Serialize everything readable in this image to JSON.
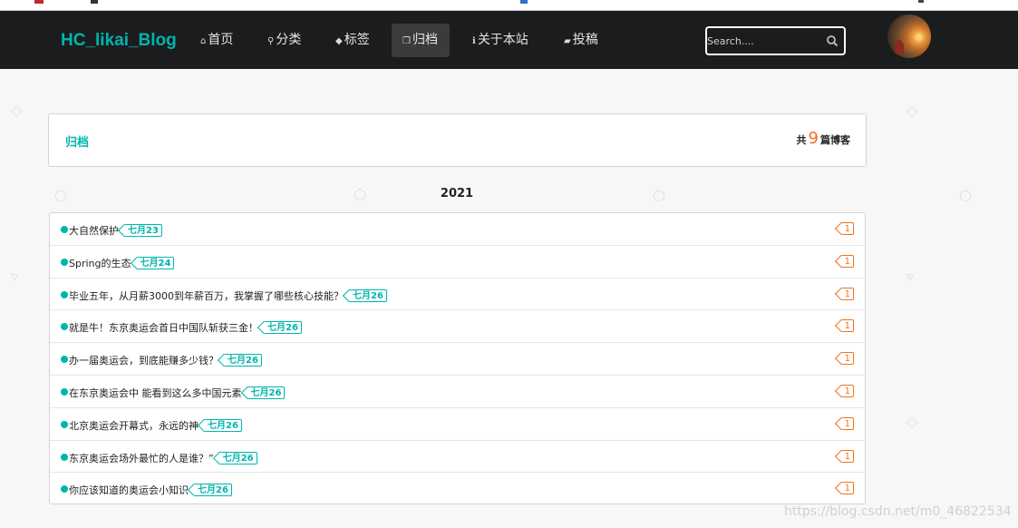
{
  "navbar": {
    "brand": "HC_likai_Blog",
    "items": [
      {
        "label": "首页",
        "icon": "home-icon"
      },
      {
        "label": "分类",
        "icon": "map-pin-icon"
      },
      {
        "label": "标签",
        "icon": "tags-icon"
      },
      {
        "label": "归档",
        "icon": "clone-icon",
        "active": true
      },
      {
        "label": "关于本站",
        "icon": "info-icon"
      },
      {
        "label": "投稿",
        "icon": "book-icon"
      }
    ],
    "search": {
      "placeholder": "Search...."
    }
  },
  "header": {
    "title": "归档",
    "count_prefix": "共",
    "count": "9",
    "count_suffix": "篇博客"
  },
  "archive": {
    "year": "2021",
    "posts": [
      {
        "title": "大自然保护",
        "date": "七月23",
        "comments": "1"
      },
      {
        "title": "Spring的生态",
        "date": "七月24",
        "comments": "1"
      },
      {
        "title": "毕业五年，从月薪3000到年薪百万，我掌握了哪些核心技能？",
        "date": "七月26",
        "comments": "1"
      },
      {
        "title": "就是牛！东京奥运会首日中国队斩获三金！",
        "date": "七月26",
        "comments": "1"
      },
      {
        "title": "办一届奥运会，到底能赚多少钱？",
        "date": "七月26",
        "comments": "1"
      },
      {
        "title": "在东京奥运会中 能看到这么多中国元素",
        "date": "七月26",
        "comments": "1"
      },
      {
        "title": "北京奥运会开幕式，永远的神",
        "date": "七月26",
        "comments": "1"
      },
      {
        "title": "东京奥运会场外最忙的人是谁？”",
        "date": "七月26",
        "comments": "1"
      },
      {
        "title": "你应该知道的奥运会小知识",
        "date": "七月26",
        "comments": "1"
      }
    ]
  },
  "watermark": "https://blog.csdn.net/m0_46822534",
  "colors": {
    "accent": "#00b5ad",
    "comment": "#f2711c",
    "navbar": "#1b1c1d"
  }
}
